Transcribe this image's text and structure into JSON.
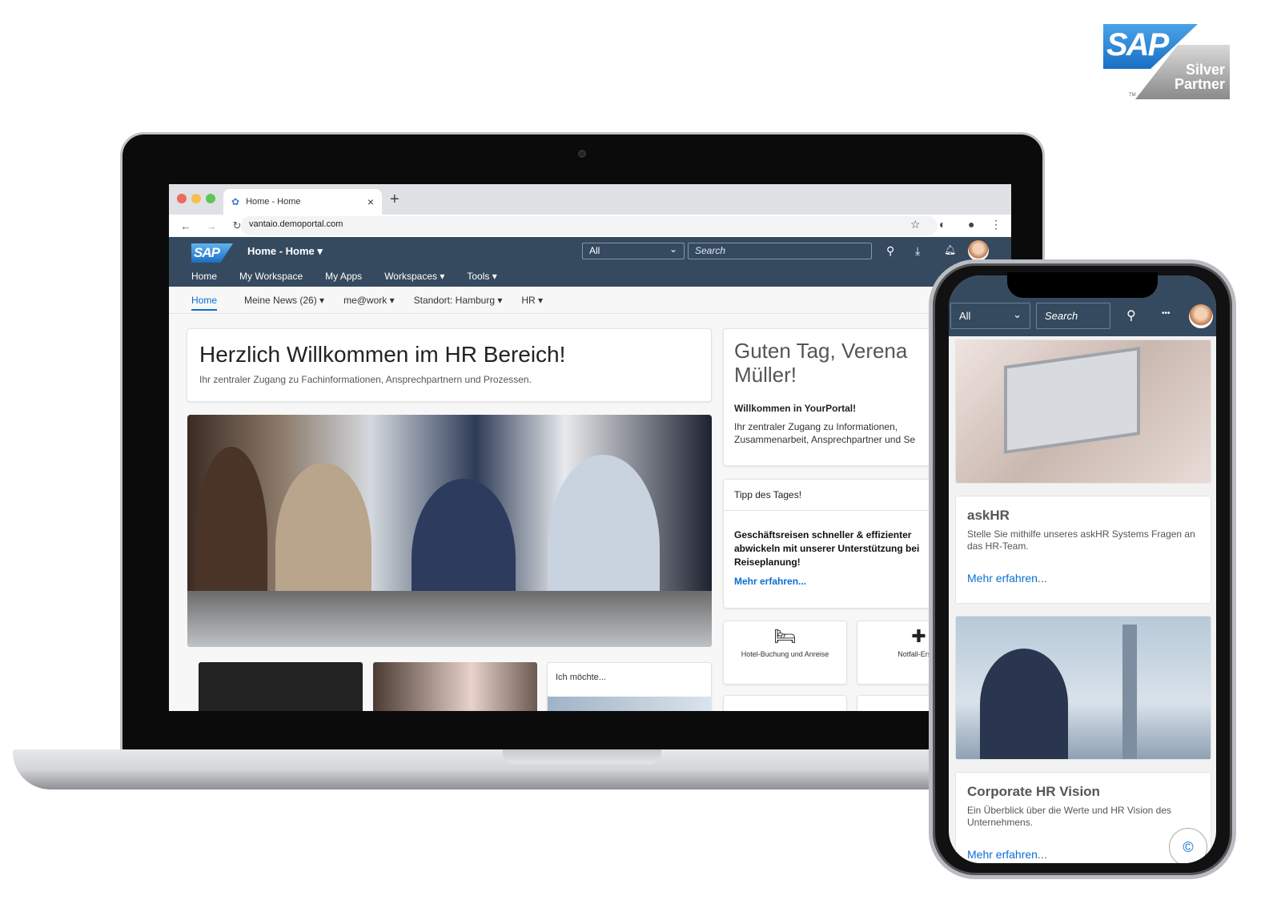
{
  "partner_badge": {
    "brand": "SAP",
    "line1": "Silver",
    "line2": "Partner",
    "tm": "TM"
  },
  "browser": {
    "tab_title": "Home - Home",
    "new_tab": "+",
    "close": "×",
    "url": "vantaio.demoportal.com",
    "icons": {
      "back": "←",
      "forward": "→",
      "reload": "↻",
      "bookmark": "☆",
      "extension": "◐",
      "profile": "●",
      "menu": "⋮"
    }
  },
  "shell": {
    "logo": "SAP",
    "title": "Home - Home ▾",
    "scope_select": "All",
    "search_placeholder": "Search",
    "menu": [
      "Home",
      "My Workspace",
      "My Apps",
      "Workspaces ▾",
      "Tools ▾"
    ],
    "icons": {
      "search": "⚲",
      "download": "⤓",
      "bell": "🔔︎"
    }
  },
  "subnav": {
    "items": [
      "Home",
      "Meine News (26) ▾",
      "me@work ▾",
      "Standort: Hamburg ▾",
      "HR ▾"
    ],
    "active": "Home"
  },
  "welcome": {
    "title": "Herzlich Willkommen im HR Bereich!",
    "subtitle": "Ihr zentraler Zugang zu Fachinformationen, Ansprechpartnern und Prozessen."
  },
  "greeting": {
    "title": "Guten Tag, Verena Müller!",
    "heading": "Willkommen in YourPortal!",
    "text": "Ihr zentraler Zugang zu Informationen, Zusammenarbeit, Ansprechpartner und Se"
  },
  "tip": {
    "header": "Tipp des Tages!",
    "body": "Geschäftsreisen schneller & effizienter abwickeln mit unserer Unterstützung bei Reiseplanung!",
    "link": "Mehr erfahren..."
  },
  "tiles": [
    {
      "icon": "bed",
      "glyph": "🛏︎",
      "label": "Hotel-Buchung und Anreise"
    },
    {
      "icon": "first-aid-kit",
      "glyph": "✚",
      "label": "Notfall-Erster"
    }
  ],
  "ich_moechte": "Ich möchte...",
  "phone": {
    "scope_select": "All",
    "search_placeholder": "Search",
    "more": "•••",
    "cards": [
      {
        "title": "askHR",
        "text": "Stelle Sie mithilfe unseres askHR Systems Fragen an das HR-Team.",
        "link": "Mehr erfahren..."
      },
      {
        "title": "Corporate HR Vision",
        "text": "Ein Überblick über die Werte und HR Vision des Unternehmens.",
        "link": "Mehr erfahren..."
      }
    ],
    "fab": "©"
  },
  "colors": {
    "shell": "#354a5f",
    "accent": "#0a6ed1"
  }
}
